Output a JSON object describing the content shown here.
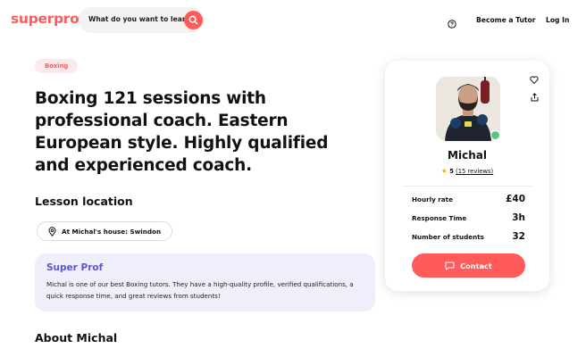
{
  "header": {
    "logo": "superprof",
    "search_placeholder": "What do you want to learn?",
    "become_tutor": "Become a Tutor",
    "login": "Log In"
  },
  "main": {
    "badge": "Boxing",
    "title": "Boxing 121 sessions with professional coach. Eastern European style. Highly qualified and experienced coach.",
    "lesson_location_heading": "Lesson location",
    "location_pill": "At Michal's house: Swindon",
    "super_prof": {
      "title": "Super Prof",
      "description": "Michal is one of our best Boxing tutors. They have a high-quality profile, verified qualifications, a quick response time, and great reviews from students!"
    },
    "about_heading": "About Michal"
  },
  "card": {
    "name": "Michal",
    "rating": "5",
    "reviews": "(15 reviews)",
    "stats": [
      {
        "label": "Hourly rate",
        "value": "£40"
      },
      {
        "label": "Response Time",
        "value": "3h"
      },
      {
        "label": "Number of students",
        "value": "32"
      }
    ],
    "contact_label": "Contact"
  },
  "colors": {
    "brand": "#ff5b5b",
    "super_prof_accent": "#5b53d8",
    "super_prof_bg": "#efeefb",
    "badge_bg": "#fde8ea",
    "verified": "#5ac57d",
    "star": "#f4b400"
  },
  "icons": [
    "search-icon",
    "help-icon",
    "location-pin-icon",
    "heart-icon",
    "share-icon",
    "verified-icon",
    "star-icon",
    "chat-icon"
  ]
}
